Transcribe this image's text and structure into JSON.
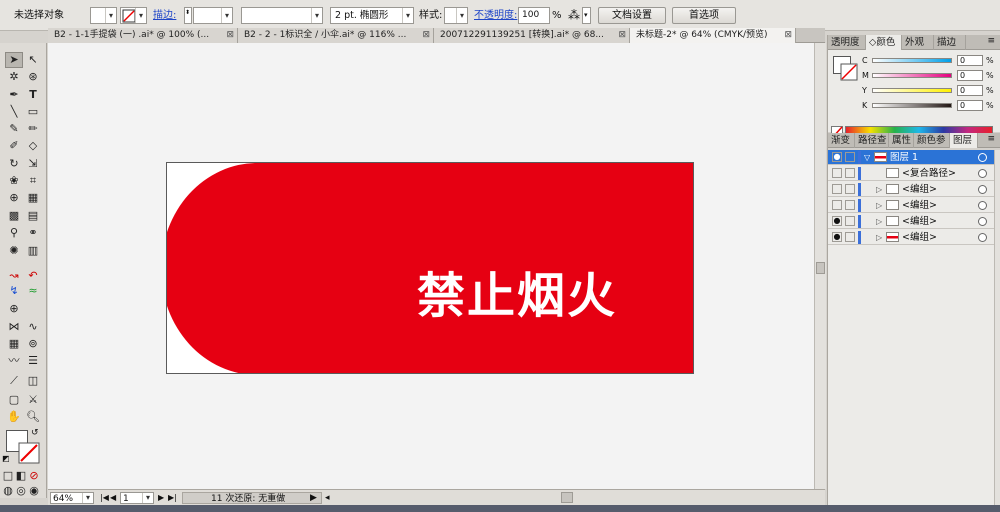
{
  "control_bar": {
    "selection_status": "未选择对象",
    "stroke_label": "描边:",
    "stroke_weight_value": "2 pt. 椭圆形",
    "style_label": "样式:",
    "opacity_label": "不透明度:",
    "opacity_value": "100",
    "opacity_unit": "%",
    "doc_setup_button": "文档设置",
    "preferences_button": "首选项"
  },
  "tabs": [
    {
      "label": "B2 - 1-1手提袋 (一) .ai* @ 100% (...",
      "close": "⊠"
    },
    {
      "label": "B2 - 2 - 1标识全 / 小伞.ai* @ 116% ...",
      "close": "⊠"
    },
    {
      "label": "200712291139251 [转换].ai* @ 68...",
      "close": "⊠"
    },
    {
      "label": "未标题-2* @ 64% (CMYK/预览)",
      "close": "⊠"
    }
  ],
  "artwork": {
    "text": "禁止烟火",
    "fill_color": "#e60012",
    "text_color": "#ffffff"
  },
  "status_bar": {
    "zoom": "64%",
    "page": "1",
    "undo_info": "11 次还原: 无重做"
  },
  "color_panel": {
    "tabs": [
      "透明度",
      "颜色",
      "外观",
      "描边"
    ],
    "active_tab": "颜色",
    "sliders": [
      {
        "key": "C",
        "value": "0",
        "unit": "%",
        "color": "#00a0e9"
      },
      {
        "key": "M",
        "value": "0",
        "unit": "%",
        "color": "#e4007f"
      },
      {
        "key": "Y",
        "value": "0",
        "unit": "%",
        "color": "#fff100"
      },
      {
        "key": "K",
        "value": "0",
        "unit": "%",
        "color": "#231815"
      }
    ]
  },
  "layers_panel": {
    "tabs": [
      "渐变",
      "路径查",
      "属性",
      "颜色参",
      "图层"
    ],
    "active_tab": "图层",
    "rows": [
      {
        "name": "图层 1",
        "selected": true,
        "visible": true,
        "twirl": "▽",
        "thumb_red": true
      },
      {
        "name": "<复合路径>",
        "selected": false,
        "visible": false,
        "twirl": "",
        "thumb_red": false
      },
      {
        "name": "<编组>",
        "selected": false,
        "visible": false,
        "twirl": "▷",
        "thumb_red": false
      },
      {
        "name": "<编组>",
        "selected": false,
        "visible": false,
        "twirl": "▷",
        "thumb_red": false
      },
      {
        "name": "<编组>",
        "selected": false,
        "visible": true,
        "twirl": "▷",
        "thumb_red": false
      },
      {
        "name": "<编组>",
        "selected": false,
        "visible": true,
        "twirl": "▷",
        "thumb_red": true
      }
    ]
  }
}
